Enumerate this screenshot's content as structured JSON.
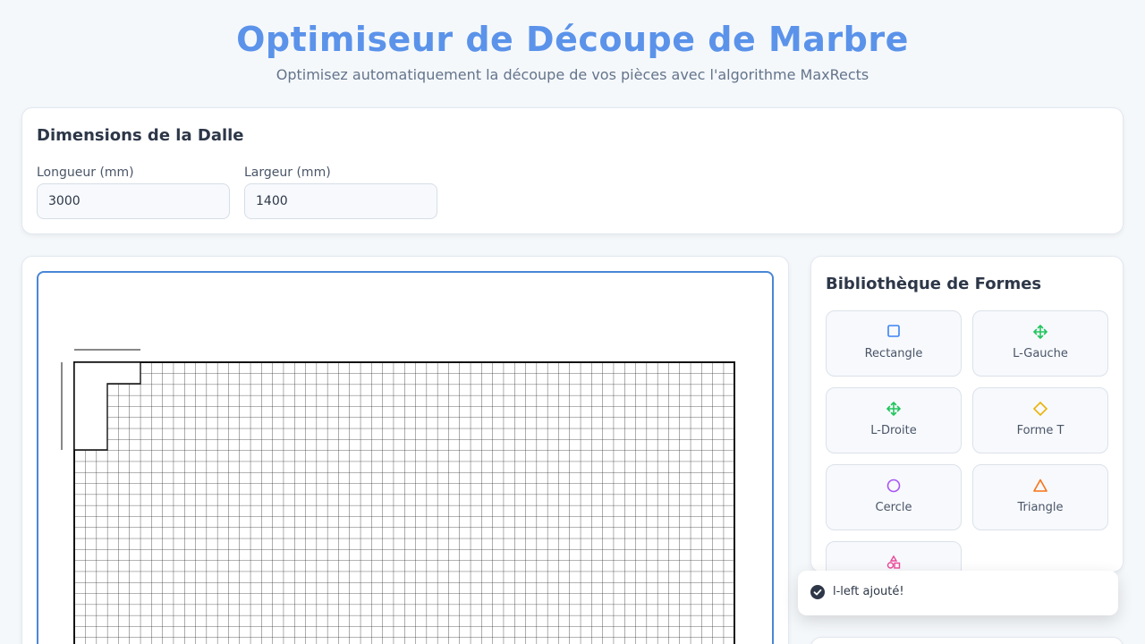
{
  "header": {
    "title": "Optimiseur de Découpe de Marbre",
    "subtitle": "Optimisez automatiquement la découpe de vos pièces avec l'algorithme MaxRects"
  },
  "slab": {
    "heading": "Dimensions de la Dalle",
    "length_label": "Longueur (mm)",
    "length_value": "3000",
    "width_label": "Largeur (mm)",
    "width_value": "1400"
  },
  "library": {
    "heading": "Bibliothèque de Formes",
    "shapes": [
      {
        "label": "Rectangle",
        "icon": "square-icon",
        "color": "#3b82f6"
      },
      {
        "label": "L-Gauche",
        "icon": "move-arrows-icon",
        "color": "#22c55e"
      },
      {
        "label": "L-Droite",
        "icon": "move-arrows-icon",
        "color": "#22c55e"
      },
      {
        "label": "Forme T",
        "icon": "diamond-icon",
        "color": "#eab308"
      },
      {
        "label": "Cercle",
        "icon": "circle-icon",
        "color": "#a855f7"
      },
      {
        "label": "Triangle",
        "icon": "triangle-icon",
        "color": "#f97316"
      },
      {
        "label": "",
        "icon": "shapes-icon",
        "color": "#ec4899"
      }
    ]
  },
  "toast": {
    "message": "l-left ajouté!",
    "icon": "check-circle-icon"
  },
  "colors": {
    "accent": "#5b93ea",
    "canvas_border": "#4a86d6"
  }
}
